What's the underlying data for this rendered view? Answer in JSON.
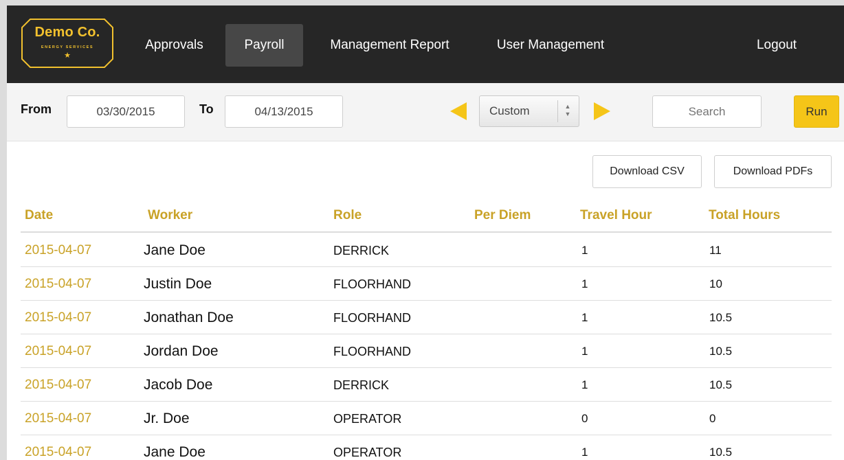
{
  "logo": {
    "title": "Demo Co.",
    "subtitle": "ENERGY SERVICES",
    "star": "★",
    "accent": "#f2c12e"
  },
  "nav": {
    "items": [
      {
        "label": "Approvals",
        "active": false
      },
      {
        "label": "Payroll",
        "active": true
      },
      {
        "label": "Management Report",
        "active": false
      },
      {
        "label": "User Management",
        "active": false
      }
    ],
    "logout": "Logout"
  },
  "filters": {
    "from_label": "From",
    "from_value": "03/30/2015",
    "to_label": "To",
    "to_value": "04/13/2015",
    "range_value": "Custom",
    "search_placeholder": "Search",
    "run_label": "Run"
  },
  "actions": {
    "download_csv": "Download CSV",
    "download_pdfs": "Download PDFs"
  },
  "table": {
    "columns": [
      "Date",
      "Worker",
      "Role",
      "Per Diem",
      "Travel Hour",
      "Total Hours"
    ],
    "rows": [
      {
        "date": "2015-04-07",
        "worker": "Jane Doe",
        "role": "DERRICK",
        "per_diem": "",
        "travel": "1",
        "total": "11"
      },
      {
        "date": "2015-04-07",
        "worker": "Justin Doe",
        "role": "FLOORHAND",
        "per_diem": "",
        "travel": "1",
        "total": "10"
      },
      {
        "date": "2015-04-07",
        "worker": "Jonathan Doe",
        "role": "FLOORHAND",
        "per_diem": "",
        "travel": "1",
        "total": "10.5"
      },
      {
        "date": "2015-04-07",
        "worker": "Jordan Doe",
        "role": "FLOORHAND",
        "per_diem": "",
        "travel": "1",
        "total": "10.5"
      },
      {
        "date": "2015-04-07",
        "worker": "Jacob Doe",
        "role": "DERRICK",
        "per_diem": "",
        "travel": "1",
        "total": "10.5"
      },
      {
        "date": "2015-04-07",
        "worker": "Jr. Doe",
        "role": "OPERATOR",
        "per_diem": "",
        "travel": "0",
        "total": "0"
      },
      {
        "date": "2015-04-07",
        "worker": "Jane Doe",
        "role": "OPERATOR",
        "per_diem": "",
        "travel": "1",
        "total": "10.5"
      }
    ]
  },
  "colors": {
    "accent_gold": "#c9a227",
    "run_yellow": "#f5c518",
    "nav_bg": "#262626"
  }
}
